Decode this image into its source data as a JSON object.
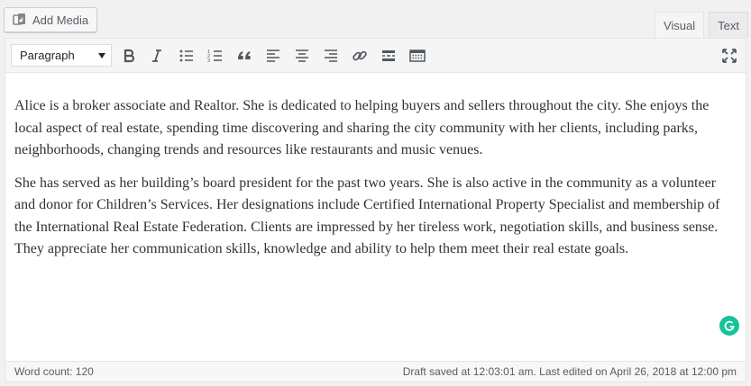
{
  "media": {
    "add_media_label": "Add Media"
  },
  "tabs": [
    {
      "label": "Visual",
      "active": true
    },
    {
      "label": "Text",
      "active": false
    }
  ],
  "toolbar": {
    "format_value": "Paragraph",
    "buttons": [
      "bold",
      "italic",
      "bulleted-list",
      "numbered-list",
      "blockquote",
      "align-left",
      "align-center",
      "align-right",
      "insert-link",
      "read-more",
      "toolbar-toggle",
      "fullscreen"
    ]
  },
  "content": {
    "paragraphs": [
      "Alice is a broker associate and Realtor. She is dedicated to helping buyers and sellers throughout the city. She enjoys the local aspect of real estate, spending time discovering and sharing the city community with her clients, including parks, neighborhoods, changing trends and resources like restaurants and music venues.",
      "She has served as her building’s board president for the past two years. She is also active in the community as a volunteer and donor for Children’s Services. Her designations include Certified International Property Specialist and membership of the International Real Estate Federation. Clients are impressed by her tireless work, negotiation skills, and business sense. They appreciate her communication skills, knowledge and ability to help them meet their real estate goals."
    ]
  },
  "status": {
    "word_count": "Word count: 120",
    "draft_saved": "Draft saved at 12:03:01 am. Last edited on April 26, 2018 at 12:00 pm"
  },
  "colors": {
    "grammarly": "#15c39a"
  }
}
